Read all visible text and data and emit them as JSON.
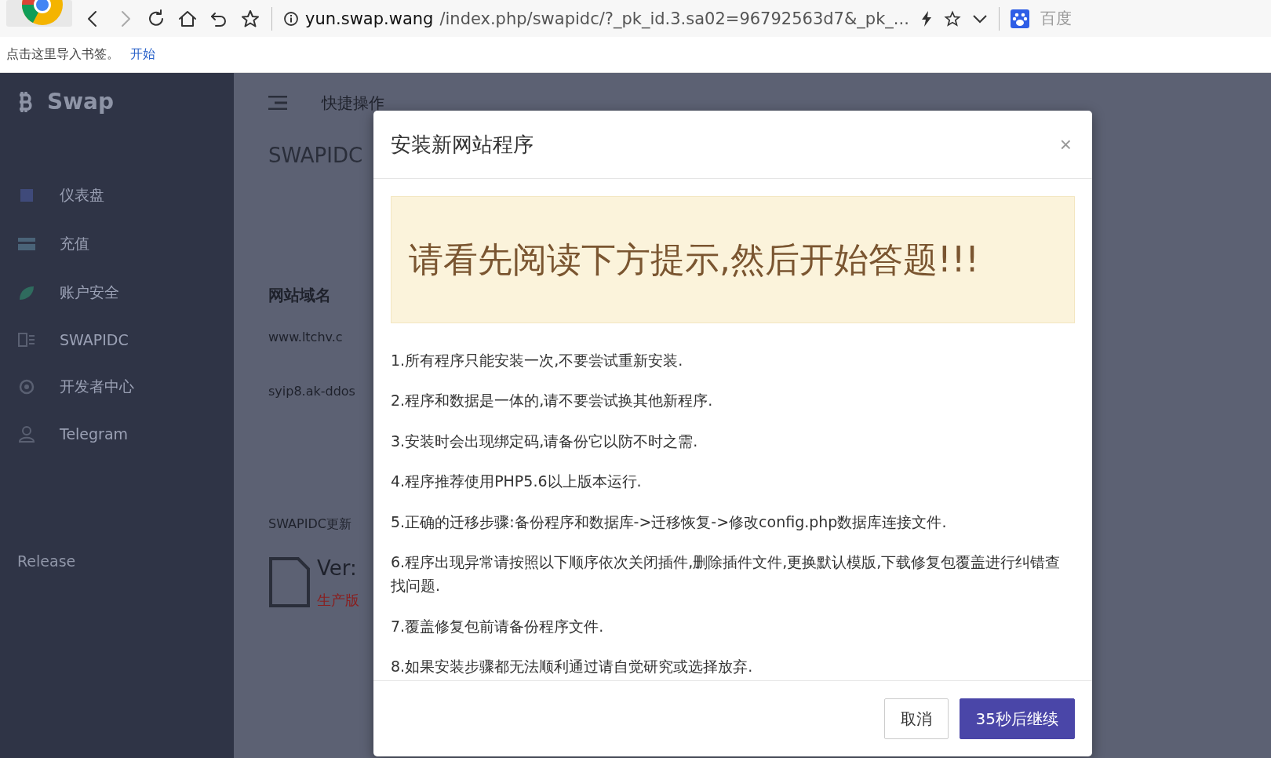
{
  "browser": {
    "nav": [
      {
        "kind": "back",
        "disabled": false
      },
      {
        "kind": "forward",
        "disabled": true
      },
      {
        "kind": "reload",
        "disabled": false
      },
      {
        "kind": "home",
        "disabled": false
      },
      {
        "kind": "undo",
        "disabled": false
      },
      {
        "kind": "star",
        "disabled": false
      }
    ],
    "url_host": "yun.swap.wang",
    "url_path": "/index.php/swapidc/?_pk_id.3.sa02=96792563d7&_pk_...",
    "search_engine": "百度"
  },
  "bookmarks_bar": {
    "hint": "点击这里导入书签。",
    "link": "开始"
  },
  "sidebar": {
    "brand": "Swap",
    "items": [
      {
        "label": "仪表盘"
      },
      {
        "label": "充值"
      },
      {
        "label": "账户安全"
      },
      {
        "label": "SWAPIDC"
      },
      {
        "label": "开发者中心"
      },
      {
        "label": "Telegram"
      }
    ],
    "footer": "Release"
  },
  "topbar": {
    "menu": "快捷操作"
  },
  "content": {
    "title": "SWAPIDC",
    "section": "网站域名",
    "domain_1": "www.ltchv.c",
    "domain_2": "syip8.ak-ddos",
    "update_heading": "SWAPIDC更新",
    "version": "Ver:",
    "edition": "生产版"
  },
  "modal": {
    "title": "安装新网站程序",
    "close": "×",
    "alert": "请看先阅读下方提示,然后开始答题!!!",
    "tips": [
      "1.所有程序只能安装一次,不要尝试重新安装.",
      "2.程序和数据是一体的,请不要尝试换其他新程序.",
      "3.安装时会出现绑定码,请备份它以防不时之需.",
      "4.程序推荐使用PHP5.6以上版本运行.",
      "5.正确的迁移步骤:备份程序和数据库->迁移恢复->修改config.php数据库连接文件.",
      "6.程序出现异常请按照以下顺序依次关闭插件,删除插件文件,更换默认模版,下载修复包覆盖进行纠错查找问题.",
      "7.覆盖修复包前请备份程序文件.",
      "8.如果安装步骤都无法顺利通过请自觉研究或选择放弃."
    ],
    "buttons": [
      {
        "label": "取消",
        "kind": "default"
      },
      {
        "label": "35秒后继续",
        "kind": "primary"
      }
    ]
  }
}
